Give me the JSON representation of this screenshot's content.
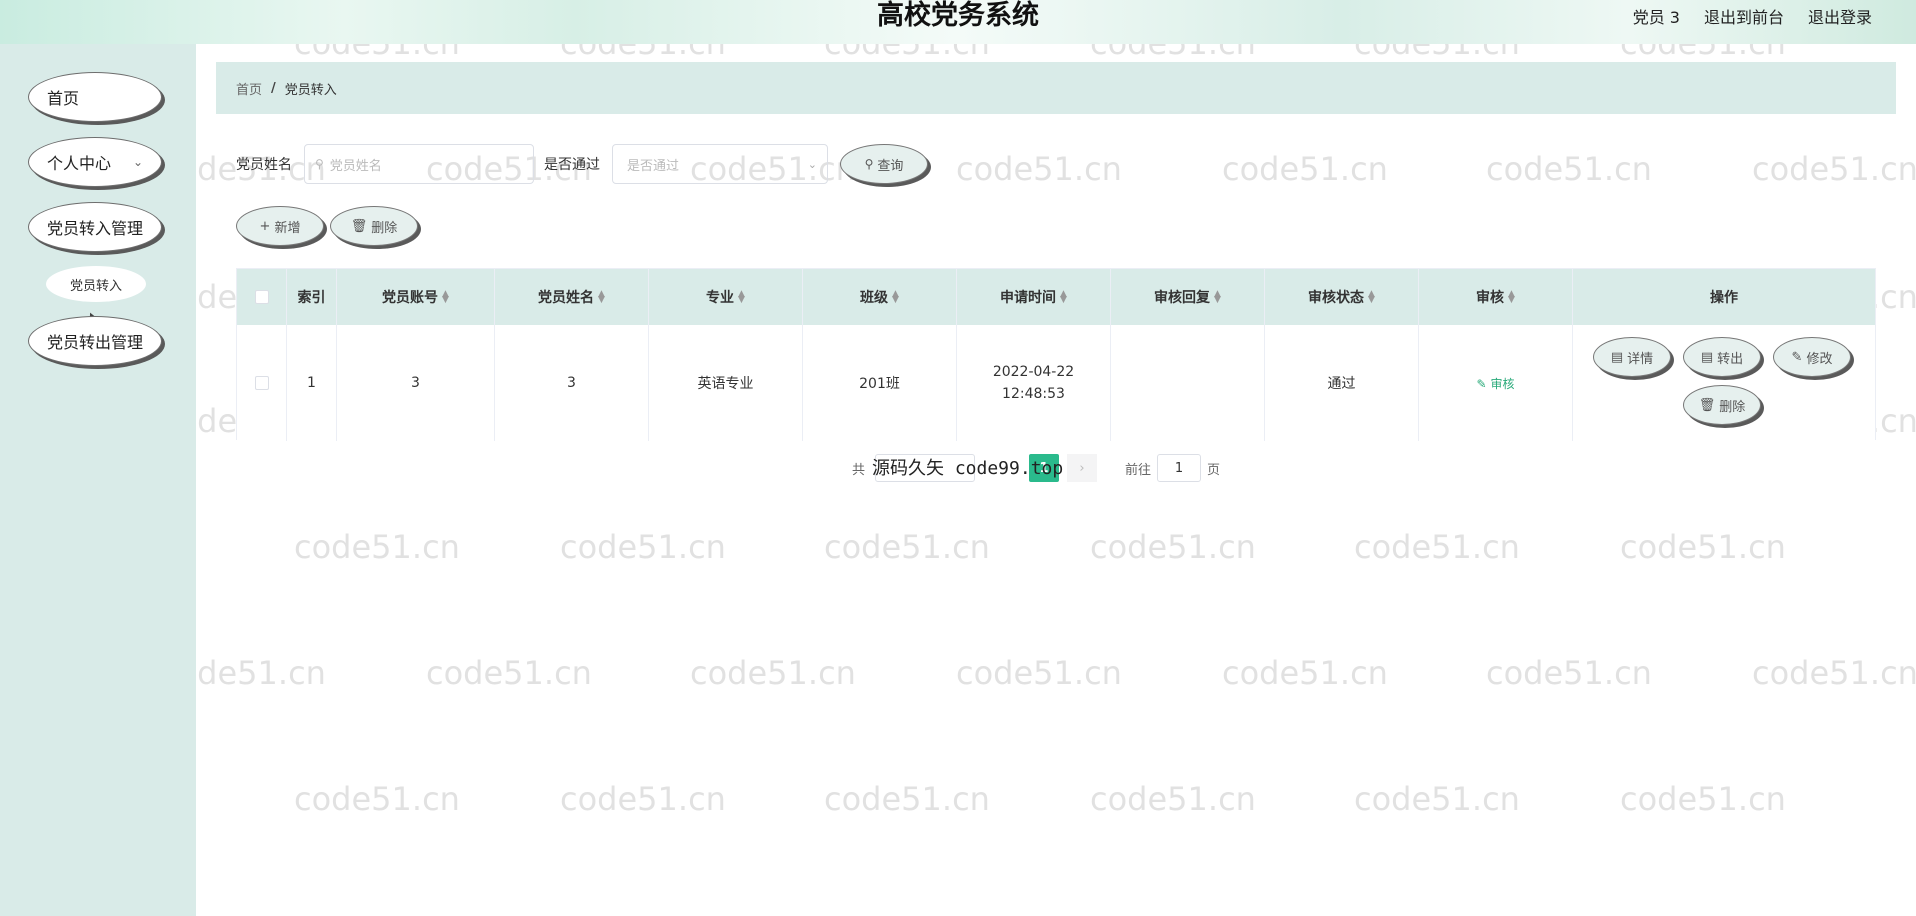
{
  "header": {
    "title": "高校党务系统",
    "user": "党员 3",
    "back_to_front": "退出到前台",
    "logout": "退出登录"
  },
  "sidebar": {
    "items": [
      {
        "label": "首页"
      },
      {
        "label": "个人中心"
      },
      {
        "label": "党员转入管理"
      },
      {
        "label": "党员转入"
      },
      {
        "label": "党员转出管理"
      }
    ]
  },
  "breadcrumb": {
    "home": "首页",
    "separator": "/",
    "current": "党员转入"
  },
  "search": {
    "name_label": "党员姓名",
    "name_placeholder": "党员姓名",
    "pass_label": "是否通过",
    "pass_placeholder": "是否通过",
    "query_button": "查询"
  },
  "actions": {
    "add": "新增",
    "delete": "删除"
  },
  "table": {
    "columns": [
      "索引",
      "党员账号",
      "党员姓名",
      "专业",
      "班级",
      "申请时间",
      "审核回复",
      "审核状态",
      "审核",
      "操作"
    ],
    "rows": [
      {
        "index": "1",
        "account": "3",
        "name": "3",
        "major": "英语专业",
        "class": "201班",
        "apply_time": "2022-04-22 12:48:53",
        "reply": "",
        "status": "通过",
        "review": "审核",
        "ops": {
          "detail": "详情",
          "transfer_out": "转出",
          "edit": "修改",
          "delete": "删除"
        }
      }
    ]
  },
  "pagination": {
    "total": "共",
    "current_page": "1",
    "goto_label": "前往",
    "goto_value": "1",
    "page_suffix": "页"
  },
  "overlay": "源码久矢 code99.top",
  "watermark": "code51.cn",
  "colors": {
    "accent": "#2aba8c",
    "sidebar_bg": "#d9ebe8"
  }
}
